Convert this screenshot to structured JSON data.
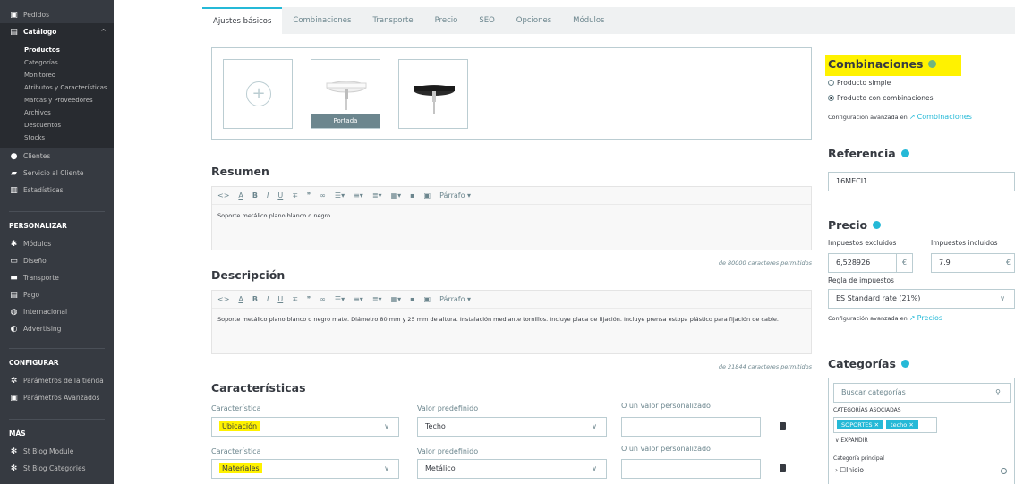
{
  "sidebar": {
    "top_items": [
      {
        "label": "Pedidos",
        "icon": "inbox-icon"
      }
    ],
    "catalog": {
      "label": "Catálogo",
      "icon": "catalog-icon"
    },
    "catalog_sub": [
      "Productos",
      "Categorías",
      "Monitoreo",
      "Atributos y Características",
      "Marcas y Proveedores",
      "Archivos",
      "Descuentos",
      "Stocks"
    ],
    "items_after": [
      {
        "label": "Clientes",
        "icon": "user-icon"
      },
      {
        "label": "Servicio al Cliente",
        "icon": "chat-icon"
      },
      {
        "label": "Estadísticas",
        "icon": "stats-icon"
      }
    ],
    "personalizar_header": "PERSONALIZAR",
    "personalizar_items": [
      {
        "label": "Módulos",
        "icon": "puzzle-icon"
      },
      {
        "label": "Diseño",
        "icon": "monitor-icon"
      },
      {
        "label": "Transporte",
        "icon": "truck-icon"
      },
      {
        "label": "Pago",
        "icon": "card-icon"
      },
      {
        "label": "Internacional",
        "icon": "globe-icon"
      },
      {
        "label": "Advertising",
        "icon": "megaphone-icon"
      }
    ],
    "configurar_header": "CONFIGURAR",
    "configurar_items": [
      {
        "label": "Parámetros de la tienda",
        "icon": "gear-icon"
      },
      {
        "label": "Parámetros Avanzados",
        "icon": "settings-icon"
      }
    ],
    "mas_header": "MÁS",
    "mas_items": [
      {
        "label": "St Blog Module",
        "icon": "blog-icon"
      },
      {
        "label": "St Blog Categories",
        "icon": "blog-icon"
      }
    ]
  },
  "tabs": [
    "Ajustes básicos",
    "Combinaciones",
    "Transporte",
    "Precio",
    "SEO",
    "Opciones",
    "Módulos"
  ],
  "images": {
    "cover_label": "Portada"
  },
  "resumen": {
    "title": "Resumen",
    "toolbar_format": "Párrafo ▾",
    "content": "Soporte metálico plano blanco o negro",
    "counter": "de 80000 caracteres permitidos"
  },
  "descripcion": {
    "title": "Descripción",
    "toolbar_format": "Párrafo ▾",
    "content": "Soporte metálico plano blanco o negro mate. Diámetro 80 mm y 25 mm de altura. Instalación mediante tornillos. Incluye placa de fijación. Incluye prensa estopa plástico para fijación de cable.",
    "counter": "de 21844 caracteres permitidos"
  },
  "caracteristicas": {
    "title": "Características",
    "col_feature": "Característica",
    "col_value": "Valor predefinido",
    "col_custom": "O un valor personalizado",
    "rows": [
      {
        "feature": "Ubicación",
        "value": "Techo",
        "custom": ""
      },
      {
        "feature": "Materiales",
        "value": "Metálico",
        "custom": ""
      }
    ]
  },
  "right": {
    "combinaciones": {
      "title": "Combinaciones",
      "option_simple": "Producto simple",
      "option_combos": "Producto con combinaciones",
      "config_prefix": "Configuración avanzada en",
      "config_link": "Combinaciones"
    },
    "referencia": {
      "title": "Referencia",
      "value": "16MECI1"
    },
    "precio": {
      "title": "Precio",
      "label_excl": "Impuestos excluidos",
      "label_incl": "Impuestos incluidos",
      "value_excl": "6,528926",
      "value_incl": "7.9",
      "currency": "€",
      "rule_label": "Regla de impuestos",
      "rule_value": "ES Standard rate (21%)",
      "config_prefix": "Configuración avanzada en",
      "config_link": "Precios"
    },
    "categorias": {
      "title": "Categorías",
      "search_placeholder": "Buscar categorías",
      "associated_label": "CATEGORÍAS ASOCIADAS",
      "chips": [
        "SOPORTES",
        "techo"
      ],
      "expand": "EXPANDIR",
      "main_label": "Categoría principal",
      "inicio": "Inicio"
    }
  },
  "colors": {
    "green": "#70b580",
    "blue": "#25b9d7",
    "highlight": "#fff200"
  }
}
